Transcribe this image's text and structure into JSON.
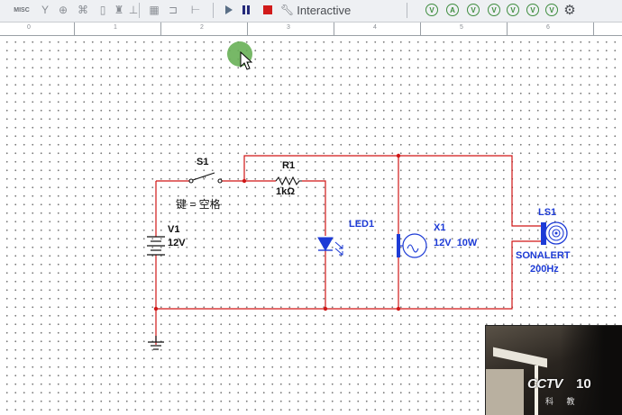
{
  "toolbar": {
    "misc_label": "MISC",
    "mode_label": "Interactive",
    "colors": {
      "play": "#5a6f86",
      "pause": "#24297a",
      "stop": "#d11b1b",
      "probe": "#3f8d3f"
    },
    "left_icons": [
      "antenna-icon",
      "gear-part-icon",
      "pin-icon",
      "grid-icon",
      "switch-icon",
      "bus-icon"
    ],
    "probe_icons": [
      "V",
      "A",
      "V",
      "V",
      "V",
      "V",
      "V"
    ]
  },
  "ruler": {
    "numbers": [
      "0",
      "1",
      "2",
      "3",
      "4",
      "5",
      "6"
    ]
  },
  "schematic": {
    "wire_color": "#d01616",
    "label_color": "#1d3bd6",
    "s1": {
      "ref": "S1",
      "key": "键 = 空格"
    },
    "r1": {
      "ref": "R1",
      "value": "1kΩ"
    },
    "v1": {
      "ref": "V1",
      "value": "12V"
    },
    "led1": {
      "ref": "LED1"
    },
    "x1": {
      "ref": "X1",
      "value": "12V_10W"
    },
    "ls1": {
      "ref": "LS1",
      "value": "SONALERT",
      "freq": "200Hz"
    }
  },
  "video_overlay": {
    "logo": "CCTV",
    "channel": "10",
    "subtitle": "科 教"
  }
}
